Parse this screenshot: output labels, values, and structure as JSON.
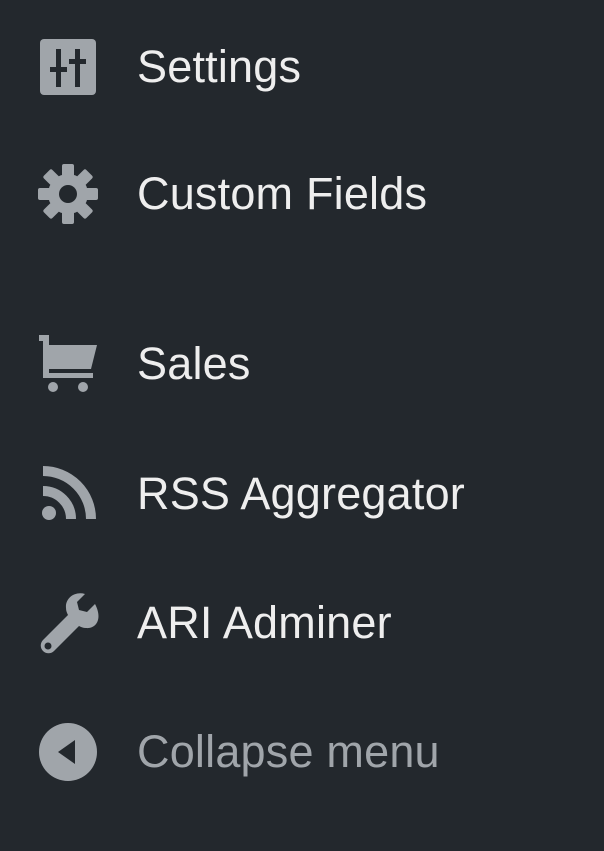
{
  "sidebar": {
    "items": [
      {
        "label": "Settings",
        "icon": "settings-sliders-icon"
      },
      {
        "label": "Custom Fields",
        "icon": "gear-icon"
      },
      {
        "label": "Sales",
        "icon": "cart-icon"
      },
      {
        "label": "RSS Aggregator",
        "icon": "rss-icon"
      },
      {
        "label": "ARI Adminer",
        "icon": "wrench-icon"
      }
    ],
    "collapse": {
      "label": "Collapse menu",
      "icon": "collapse-arrow-icon"
    }
  },
  "colors": {
    "background": "#23282d",
    "icon": "#a0a5aa",
    "text": "#eeeeee",
    "collapse_text": "#a0a5aa"
  }
}
